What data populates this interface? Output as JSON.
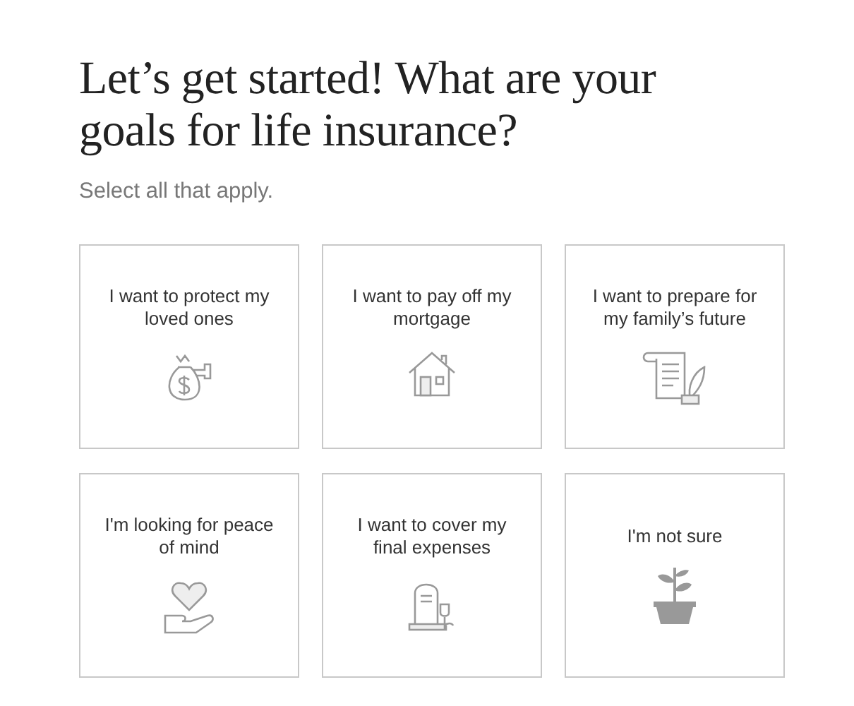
{
  "heading": "Let’s get started! What are your goals for life insurance?",
  "subheading": "Select all that apply.",
  "options": [
    {
      "label": "I want to protect my loved ones",
      "kind": "money",
      "selected": false
    },
    {
      "label": "I want to pay off my mortgage",
      "kind": "house",
      "selected": false
    },
    {
      "label": "I want to prepare for my family’s future",
      "kind": "document",
      "selected": false
    },
    {
      "label": "I'm looking for peace of mind",
      "kind": "heart",
      "selected": false
    },
    {
      "label": "I want to cover my final expenses",
      "kind": "grave",
      "selected": false
    },
    {
      "label": "I'm not sure",
      "kind": "plant",
      "selected": false
    }
  ]
}
